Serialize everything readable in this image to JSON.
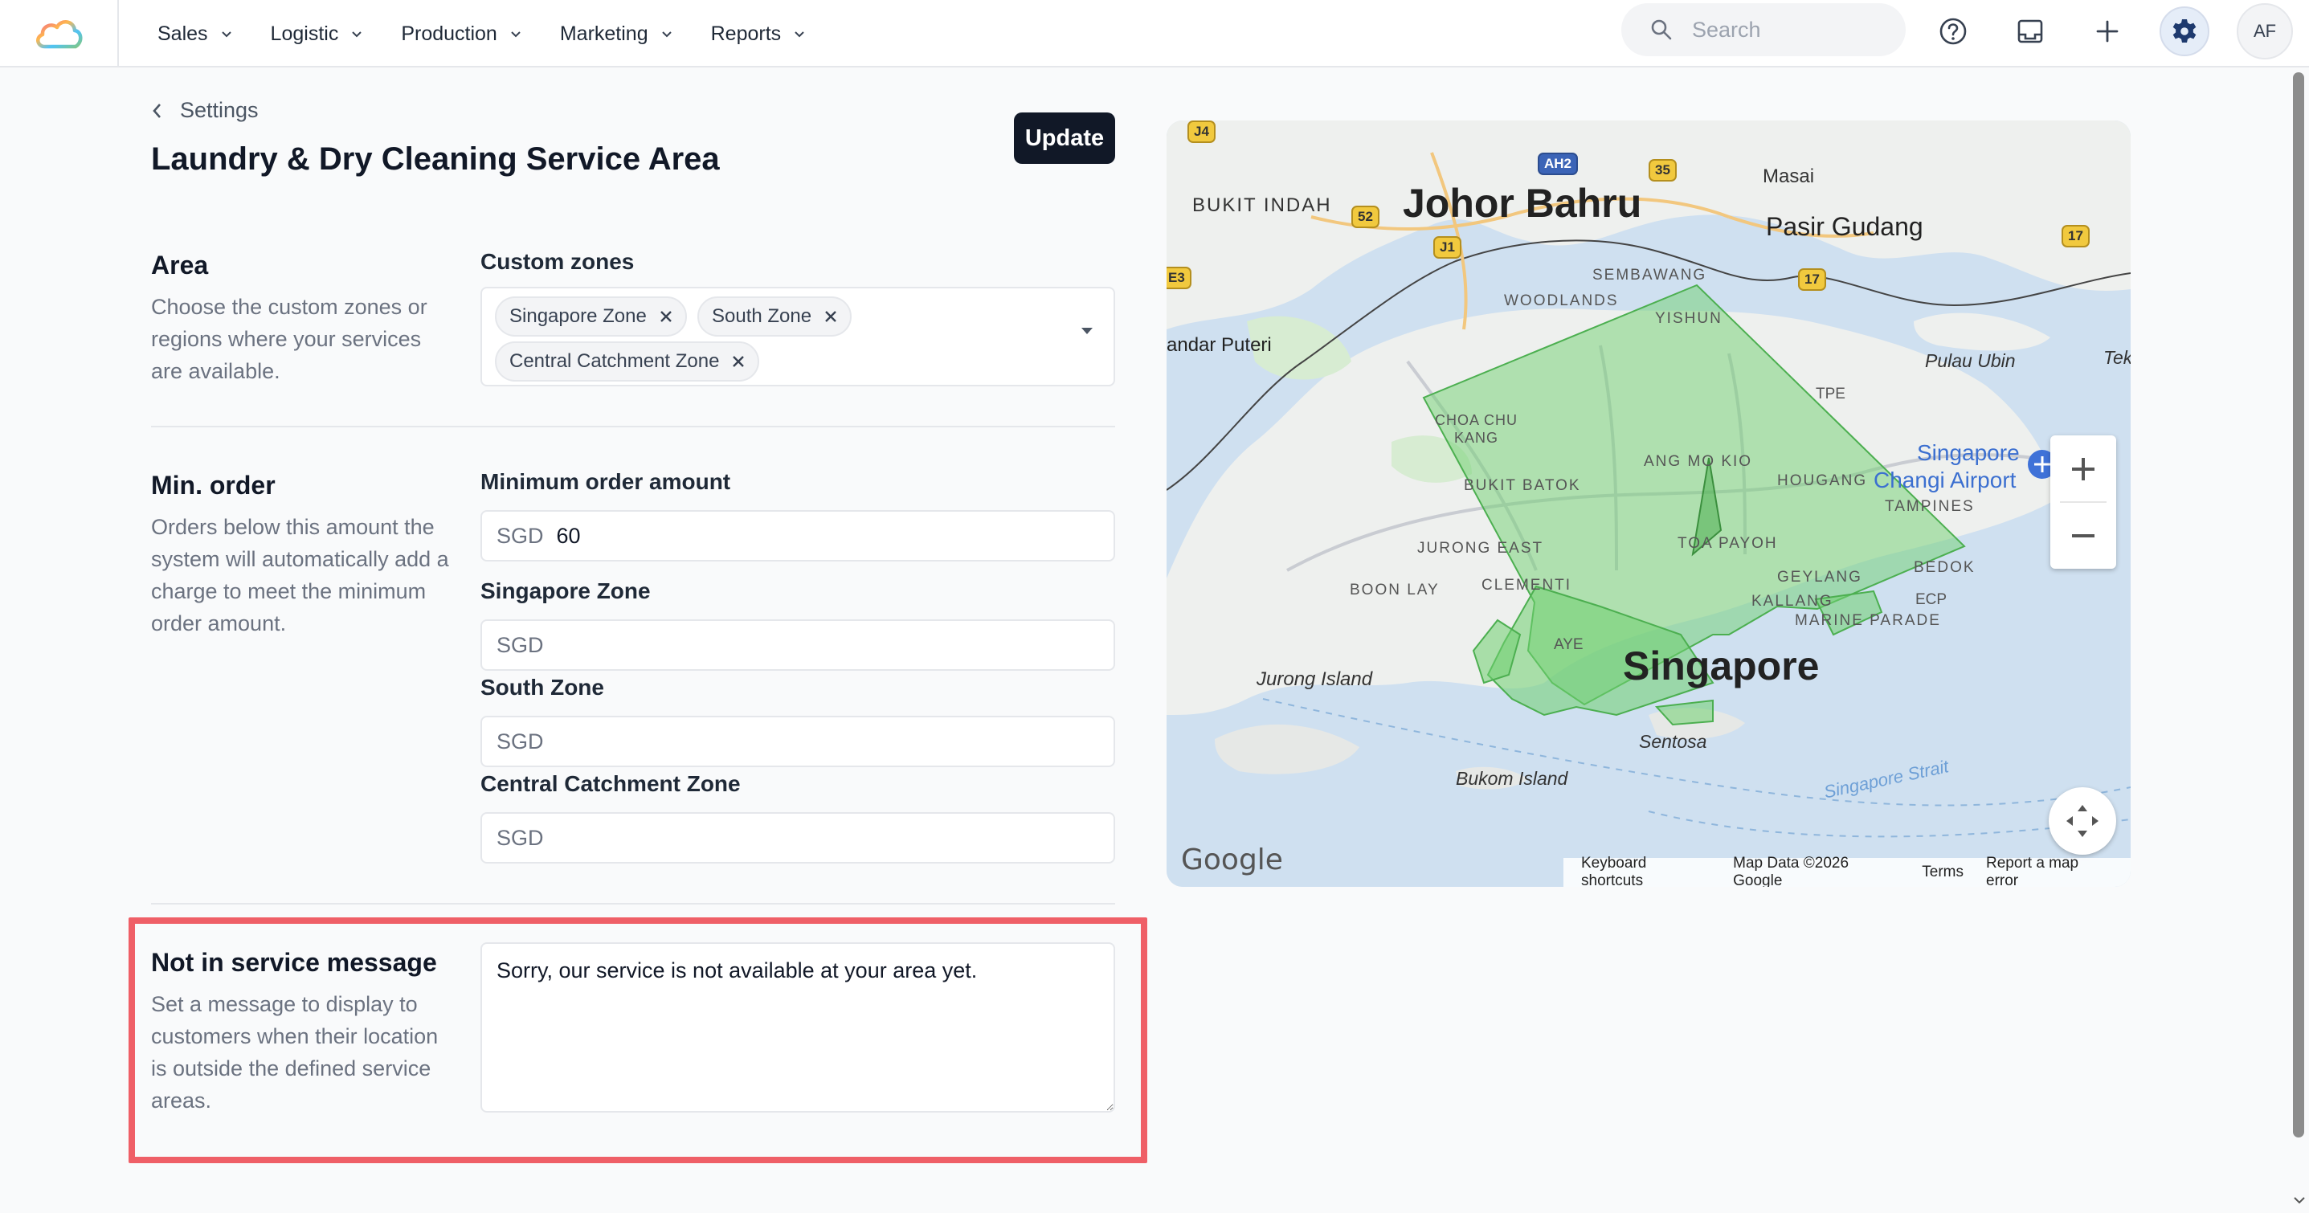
{
  "nav": {
    "items": [
      {
        "label": "Sales"
      },
      {
        "label": "Logistic"
      },
      {
        "label": "Production"
      },
      {
        "label": "Marketing"
      },
      {
        "label": "Reports"
      }
    ],
    "search_placeholder": "Search",
    "avatar_initials": "AF",
    "icons": [
      "help-icon",
      "inbox-icon",
      "plus-icon",
      "gear-icon"
    ]
  },
  "header": {
    "back_label": "Settings",
    "title": "Laundry & Dry Cleaning Service Area",
    "update_label": "Update"
  },
  "area": {
    "title": "Area",
    "description": "Choose the custom zones or regions where your services are available.",
    "field_label": "Custom zones",
    "zones": [
      "Singapore Zone",
      "South Zone",
      "Central Catchment Zone"
    ]
  },
  "min_order": {
    "title": "Min. order",
    "description": "Orders below this amount the system will automatically add a charge to meet the minimum order amount.",
    "fields": [
      {
        "label": "Minimum order amount",
        "prefix": "SGD",
        "value": "60"
      },
      {
        "label": "Singapore Zone",
        "prefix": "SGD",
        "value": ""
      },
      {
        "label": "South Zone",
        "prefix": "SGD",
        "value": ""
      },
      {
        "label": "Central Catchment Zone",
        "prefix": "SGD",
        "value": ""
      }
    ]
  },
  "not_in_service": {
    "title": "Not in service message",
    "description": "Set a message to display to customers when their location is outside the defined service areas.",
    "message": "Sorry, our service is not available at your area yet."
  },
  "map": {
    "labels": {
      "johor_bahru": "Johor Bahru",
      "bukit_indah": "BUKIT INDAH",
      "masai": "Masai",
      "pasir_gudang": "Pasir Gudang",
      "sembawang": "SEMBAWANG",
      "woodlands": "WOODLANDS",
      "yishun": "YISHUN",
      "andar_puteri": "andar Puteri",
      "pulau_ubin": "Pulau Ubin",
      "tek": "Tek",
      "tpe": "TPE",
      "choa_chu_kang": "CHOA CHU\nKANG",
      "ang_mo_kio": "ANG MO KIO",
      "hougang": "HOUGANG",
      "singapore_changi": "Singapore",
      "changi_airport": "Changi Airport",
      "tampines": "TAMPINES",
      "bukit_batok": "BUKIT BATOK",
      "jurong_east": "JURONG EAST",
      "toa_payoh": "TOA PAYOH",
      "geylang": "GEYLANG",
      "bedok": "BEDOK",
      "boon_lay": "BOON LAY",
      "clementi": "CLEMENTI",
      "kallang": "KALLANG",
      "marine_parade": "MARINE PARADE",
      "ecp": "ECP",
      "ave": "AYE",
      "jurong_island": "Jurong Island",
      "singapore": "Singapore",
      "sentosa": "Sentosa",
      "bukom_island": "Bukom Island",
      "singapore_strait": "Singapore Strait"
    },
    "shields": [
      "J4",
      "AH2",
      "35",
      "52",
      "J1",
      "17",
      "17",
      "E3"
    ],
    "google": "Google",
    "attribution": [
      "Keyboard shortcuts",
      "Map Data ©2026 Google",
      "Terms",
      "Report a map error"
    ],
    "polygon_fill": "#6fcf6f"
  },
  "colors": {
    "highlight_border": "#ef5f67",
    "primary_button": "#111827"
  }
}
